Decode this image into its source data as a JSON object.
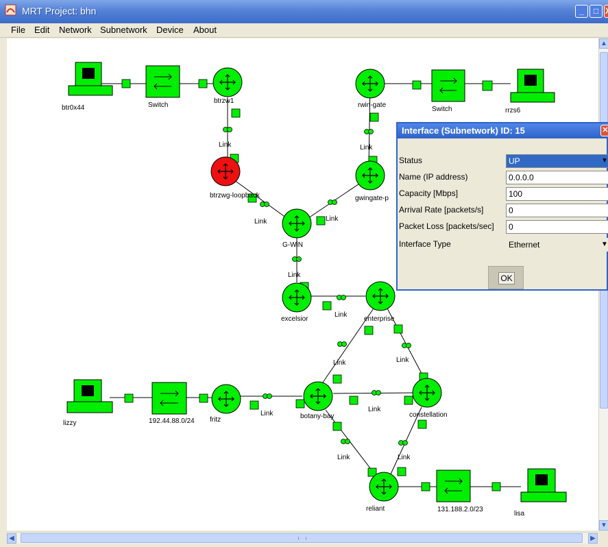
{
  "window": {
    "title": "MRT  Project: bhn",
    "buttons": {
      "minimize": "_",
      "maximize": "□",
      "close": "X"
    }
  },
  "menu": [
    "File",
    "Edit",
    "Network",
    "Subnetwork",
    "Device",
    "About"
  ],
  "nodes": {
    "btr0x44": "btr0x44",
    "switch1": "Switch",
    "btrzw1": "btrzw1",
    "rwingate": "rwin-gate",
    "switch2": "Switch",
    "rrzs6": "rrzs6",
    "btrzwgloopback": "btrzwg-loopback",
    "gwingatep": "gwingate-p",
    "gwin": "G-WiN",
    "excelsior": "excelsior",
    "enterprise": "enterprise",
    "lizzy": "lizzy",
    "subnet1": "192.44.88.0/24",
    "fritz": "fritz",
    "botanybay": "botany-bay",
    "constellation": "constellation",
    "reliant": "reliant",
    "subnet2": "131.188.2.0/23",
    "lisa": "lisa"
  },
  "link_label": "Link",
  "colors": {
    "node_up": "#00ee00",
    "node_down": "#ee1111",
    "dialog_title": "#2f63c9"
  },
  "dialog": {
    "title": "Interface (Subnetwork) ID: 15",
    "fields": [
      {
        "label": "Status",
        "value": "UP"
      },
      {
        "label": "Name (IP address)",
        "value": "0.0.0.0"
      },
      {
        "label": "Capacity [Mbps]",
        "value": "100"
      },
      {
        "label": "Arrival Rate [packets/s]",
        "value": "0"
      },
      {
        "label": "Packet Loss [packets/sec]",
        "value": "0"
      },
      {
        "label": "Interface Type",
        "value": "Ethernet"
      }
    ],
    "ok_label": "OK"
  }
}
